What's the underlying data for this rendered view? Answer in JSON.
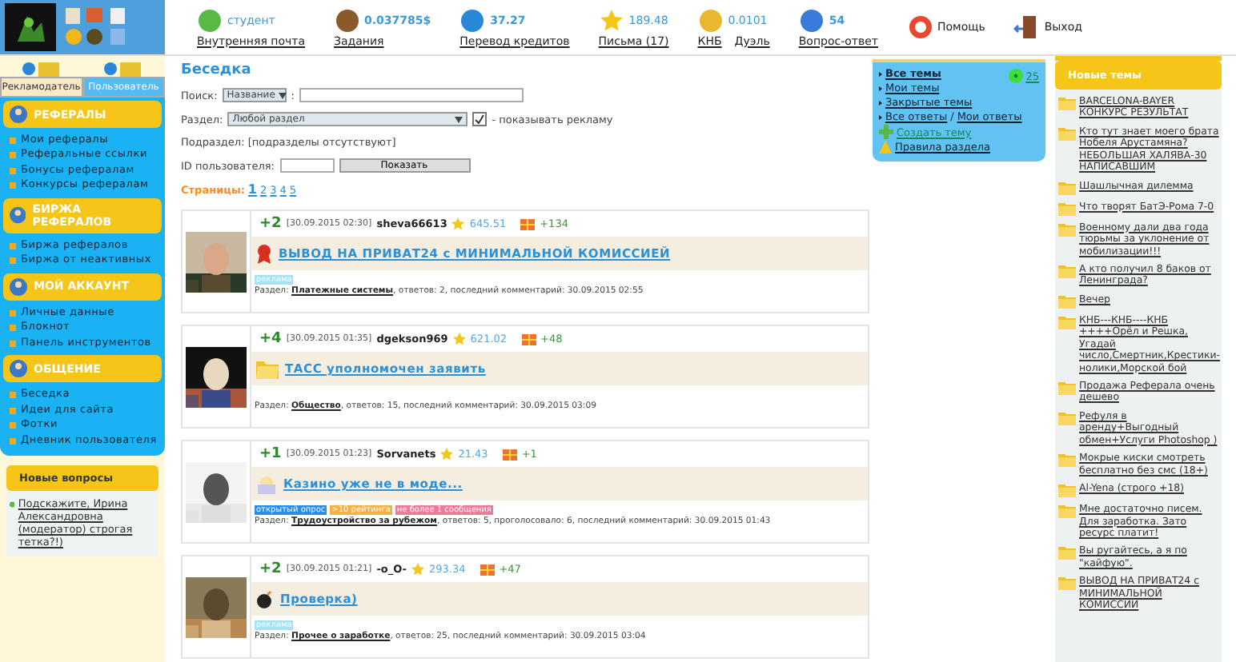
{
  "header": {
    "nav": [
      {
        "kind": "stacked",
        "value": "студент",
        "labels": [
          "Внутренняя почта"
        ]
      },
      {
        "kind": "stacked",
        "value": "0.037785$",
        "labels": [
          "Задания"
        ]
      },
      {
        "kind": "stacked",
        "value": "37.27",
        "labels": [
          "Перевод кредитов"
        ]
      },
      {
        "kind": "stacked",
        "value": "189.48",
        "labels": [
          "Письма (17)"
        ]
      },
      {
        "kind": "stacked",
        "value": "0.0101",
        "labels": [
          "КНБ",
          "Дуэль"
        ]
      },
      {
        "kind": "stacked",
        "value": "54",
        "labels": [
          "Вопрос-ответ"
        ]
      },
      {
        "kind": "inline",
        "labels": [
          "Помощь"
        ]
      },
      {
        "kind": "inline",
        "labels": [
          "Выход"
        ]
      }
    ]
  },
  "sidebar": {
    "tabs": [
      {
        "label": "Рекламодатель",
        "selected": false
      },
      {
        "label": "Пользователь",
        "selected": true
      }
    ],
    "sections": [
      {
        "title": "РЕФЕРАЛЫ",
        "items": [
          "Мои рефералы",
          "Реферальные ссылки",
          "Бонусы рефералам",
          "Конкурсы рефералам"
        ]
      },
      {
        "title": "БИРЖА РЕФЕРАЛОВ",
        "items": [
          "Биржа рефералов",
          "Биржа от неактивных"
        ]
      },
      {
        "title": "МОЙ АККАУНТ",
        "items": [
          "Личные данные",
          "Блокнот",
          "Панель инструментов"
        ]
      },
      {
        "title": "ОБЩЕНИЕ",
        "items": [
          "Беседка",
          "Идеи для сайта",
          "Фотки",
          "Дневник пользователя"
        ]
      }
    ],
    "questions": {
      "title": "Новые вопросы",
      "items": [
        "Подскажите, Ирина Александровна (модератор) строгая тетка?!)"
      ]
    }
  },
  "main": {
    "title": "Беседка",
    "search": {
      "label": "Поиск:",
      "field": "Название",
      "separator": ":"
    },
    "section": {
      "label": "Раздел:",
      "value": "Любой раздел",
      "checked": true,
      "checkbox_label": "- показывать рекламу"
    },
    "subsection": "Подраздел: [подразделы отсутствуют]",
    "user_id": {
      "label": "ID пользователя:",
      "button": "Показать"
    },
    "pages": {
      "label": "Страницы:",
      "items": [
        {
          "label": "1",
          "selected": true
        },
        {
          "label": "2",
          "selected": false
        },
        {
          "label": "3",
          "selected": false
        },
        {
          "label": "4",
          "selected": false
        },
        {
          "label": "5",
          "selected": false
        }
      ]
    },
    "posts": [
      {
        "score": "+2",
        "date": "[30.09.2015 02:30]",
        "user": "sheva66613",
        "rating": "645.51",
        "gifts": "+134",
        "kind": "ad",
        "title": "ВЫВОД НА ПРИВАТ24 с МИНИМАЛЬНОЙ КОМИССИЕЙ",
        "tags": [
          {
            "text": "реклама",
            "color": "#a8e0f8"
          }
        ],
        "section_label": "Раздел:",
        "section": "Платежные системы",
        "details": ", ответов: 2, последний комментарий: 30.09.2015 02:55"
      },
      {
        "score": "+4",
        "date": "[30.09.2015 01:35]",
        "user": "dgekson969",
        "rating": "621.02",
        "gifts": "+48",
        "kind": "topic",
        "title": "ТАСС уполномочен заявить",
        "section_label": "Раздел:",
        "section": "Общество",
        "details": ", ответов: 15, последний комментарий: 30.09.2015 03:09"
      },
      {
        "score": "+1",
        "date": "[30.09.2015 01:23]",
        "user": "Sorvanets",
        "rating": "21.43",
        "gifts": "+1",
        "kind": "poll",
        "title": "Казино уже не в моде...",
        "tags": [
          {
            "text": "открытый опрос",
            "color": "#2a8ee8"
          },
          {
            "text": ">10 рейтинга",
            "color": "#f8b040"
          },
          {
            "text": "не более 1 сообщения",
            "color": "#f07898"
          }
        ],
        "section_label": "Раздел:",
        "section": "Трудоустройство за рубежом",
        "details": ", ответов: 5, проголосовало: 6, последний комментарий: 30.09.2015 01:43"
      },
      {
        "score": "+2",
        "date": "[30.09.2015 01:21]",
        "user": "-o_O-",
        "rating": "293.34",
        "gifts": "+47",
        "kind": "check",
        "title": "Проверка)",
        "tags": [
          {
            "text": "реклама",
            "color": "#a8e0f8"
          }
        ],
        "section_label": "Раздел:",
        "section": "Прочее о заработке",
        "details": ", ответов: 25, последний комментарий: 30.09.2015 03:04"
      }
    ]
  },
  "topics_box": {
    "count": "25",
    "items": [
      {
        "kind": "bullet",
        "links": [
          "Все темы"
        ],
        "selected": true
      },
      {
        "kind": "bullet",
        "links": [
          "Мои темы"
        ],
        "selected": false
      },
      {
        "kind": "bullet",
        "links": [
          "Закрытые темы"
        ],
        "selected": false
      },
      {
        "kind": "bullet",
        "links": [
          "Все ответы",
          "Мои ответы"
        ],
        "separator": "/",
        "selected": false
      },
      {
        "kind": "create",
        "links": [
          "Создать тему"
        ],
        "selected": false
      },
      {
        "kind": "rules",
        "links": [
          "Правила раздела"
        ],
        "selected": false
      }
    ]
  },
  "new_topics": {
    "title": "Новые темы",
    "items": [
      "BARCELONA-BAYER КОНКУРС РЕЗУЛЬТАТ",
      "Кто тут знает моего брата Нобеля Арустамяна? НЕБОЛЬШАЯ ХАЛЯВА-30 НАПИСАВШИМ",
      "Шашлычная дилемма",
      "Что творят БатЭ-Рома 7-0",
      "Военному дали два года тюрьмы за уклонение от мобилизации!!!",
      "А кто получил 8 баков от Ленинграда?",
      "Вечер",
      "КНБ---КНБ----КНБ ++++Орёл и Решка, Угадай число,Смертник,Крестики-нолики,Морской бой",
      "Продажа Реферала очень дешево",
      "Рефуля в аренду+Выгодный обмен+Услуги Photoshop )",
      "Мокрые киски смотреть бесплатно без смс (18+)",
      "Al-Yena (строго +18)",
      "Мне достаточно писем. Для заработка. Зато ресурс платит!",
      "Вы ругайтесь, а я по \"кайфую\".",
      "ВЫВОД НА ПРИВАТ24 с МИНИМАЛЬНОЙ КОМИССИИ"
    ]
  }
}
